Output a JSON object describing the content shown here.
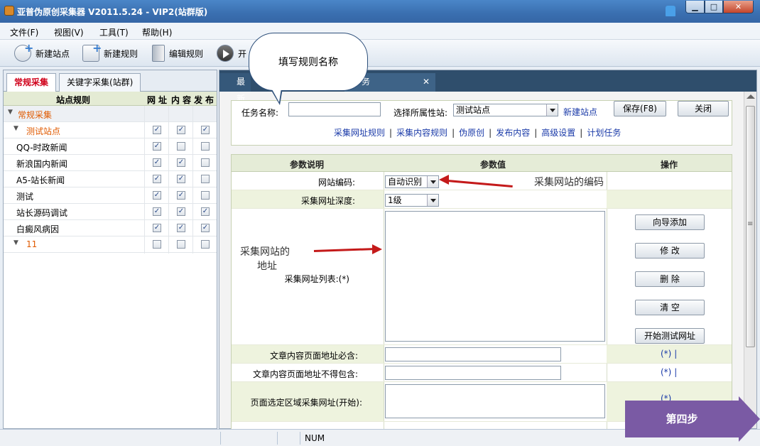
{
  "window": {
    "title": "亚普伪原创采集器 V2011.5.24 - VIP2(站群版)"
  },
  "menu": [
    "文件(F)",
    "视图(V)",
    "工具(T)",
    "帮助(H)"
  ],
  "toolbar": {
    "new_site": "新建站点",
    "new_rule": "新建规则",
    "edit_rule": "编辑规则",
    "start": "开"
  },
  "callout": "填写规则名称",
  "left": {
    "tabs": [
      "常规采集",
      "关键字采集(站群)"
    ],
    "head": {
      "site_rules": "站点规则",
      "col1": "网",
      "col2": "址",
      "col3": "内",
      "col4": "容",
      "col5": "发",
      "col6": "布"
    },
    "rows": [
      {
        "name": "常规采集",
        "type": "group",
        "c": null
      },
      {
        "name": "测试站点",
        "type": "site",
        "c": [
          true,
          true,
          true
        ]
      },
      {
        "name": "QQ-时政新闻",
        "type": "item",
        "c": [
          true,
          false,
          false
        ]
      },
      {
        "name": "新浪国内新闻",
        "type": "item",
        "c": [
          true,
          true,
          false
        ]
      },
      {
        "name": "A5-站长新闻",
        "type": "item",
        "c": [
          true,
          true,
          false
        ]
      },
      {
        "name": "测试",
        "type": "item",
        "c": [
          true,
          true,
          false
        ]
      },
      {
        "name": "站长源码调试",
        "type": "item",
        "c": [
          true,
          true,
          true
        ]
      },
      {
        "name": "白癜风病因",
        "type": "item",
        "c": [
          true,
          true,
          true
        ]
      },
      {
        "name": "11",
        "type": "site",
        "c": [
          false,
          false,
          false
        ]
      }
    ]
  },
  "right": {
    "tabs": [
      "最新",
      "务"
    ],
    "task": {
      "name_label": "任务名称:",
      "name_value": "",
      "site_label": "选择所属性站:",
      "site_value": "测试站点",
      "new_site_link": "新建站点",
      "save": "保存(F8)",
      "close": "关闭",
      "links": [
        "采集网址规则",
        "采集内容规则",
        "伪原创",
        "发布内容",
        "高级设置",
        "计划任务"
      ]
    },
    "params": {
      "head": [
        "参数说明",
        "参数值",
        "操作"
      ],
      "encoding_label": "网站编码:",
      "encoding_value": "自动识别",
      "depth_label": "采集网址深度:",
      "depth_value": "1级",
      "url_list_label": "采集网址列表:(*)",
      "buttons": [
        "向导添加",
        "修 改",
        "删 除",
        "清 空",
        "开始测试网址"
      ],
      "must_contain_label": "文章内容页面地址必含:",
      "must_not_contain_label": "文章内容页面地址不得包含:",
      "region_label": "页面选定区域采集网址(开始):",
      "op_star": "(*)",
      "op_bar": "|"
    },
    "annotations": {
      "encoding": "采集网站的编码",
      "address_1": "采集网站的",
      "address_2": "地址"
    }
  },
  "step": "第四步",
  "status": {
    "num": "NUM"
  },
  "colors": {
    "arrow": "#c41a1a",
    "step": "#7a5aa4",
    "title_bar": "#3a6fb0",
    "tab_bar": "#2f4e6c"
  }
}
